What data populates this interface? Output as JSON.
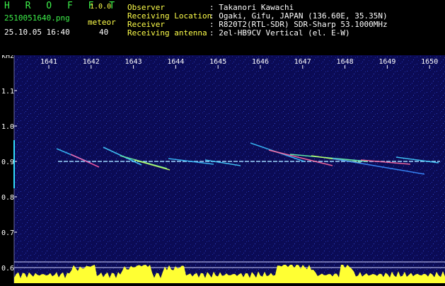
{
  "header": {
    "logo": "H R O F F T",
    "version": "1.0.0",
    "filename": "2510051640.png",
    "datetime": "25.10.05 16:40",
    "meteor_label": "meteor",
    "meteor_count": "40",
    "info": [
      {
        "key": "Observer",
        "value": ": Takanori Kawachi"
      },
      {
        "key": "Receiving Location",
        "value": ": Ogaki, Gifu, JAPAN (136.60E, 35.35N)"
      },
      {
        "key": "Receiver",
        "value": ": R820T2(RTL-SDR) SDR-Sharp 53.1000MHz"
      },
      {
        "key": "Receiving antenna",
        "value": ": 2el-HB9CV Vertical (el. E-W)"
      }
    ]
  },
  "spectrogram": {
    "y_unit": "kHz",
    "y_ticks": [
      "1.1",
      "1.0",
      "0.9",
      "0.8",
      "0.7",
      "0.6"
    ],
    "x_ticks": [
      "1641",
      "1642",
      "1643",
      "1644",
      "1645",
      "1646",
      "1647",
      "1648",
      "1649",
      "1650"
    ],
    "colors": {
      "background": "#0a0a5a",
      "carrier": "#9fd8ff",
      "label": "#ffffff",
      "level": "#ffff33"
    }
  }
}
